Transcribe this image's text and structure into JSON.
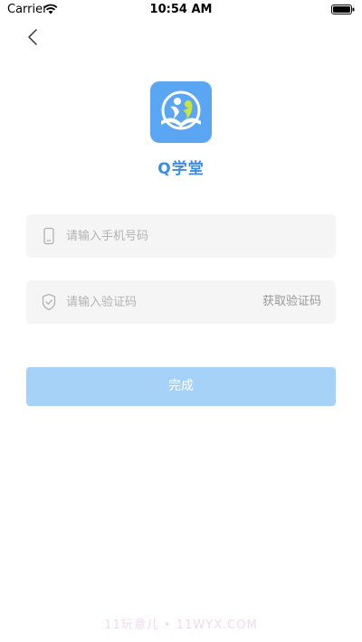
{
  "status_bar": {
    "carrier": "Carrier",
    "time": "10:54 AM"
  },
  "app": {
    "name": "Q学堂",
    "logo_color": "#5aa6f3",
    "name_color": "#3a8ee6"
  },
  "form": {
    "phone": {
      "placeholder": "请输入手机号码",
      "value": "",
      "icon": "phone-icon"
    },
    "code": {
      "placeholder": "请输入验证码",
      "value": "",
      "icon": "shield-check-icon",
      "get_code_label": "获取验证码"
    },
    "submit_label": "完成",
    "submit_color": "#a6d2f7"
  },
  "watermark": "11玩意儿 • 11WYX.COM"
}
